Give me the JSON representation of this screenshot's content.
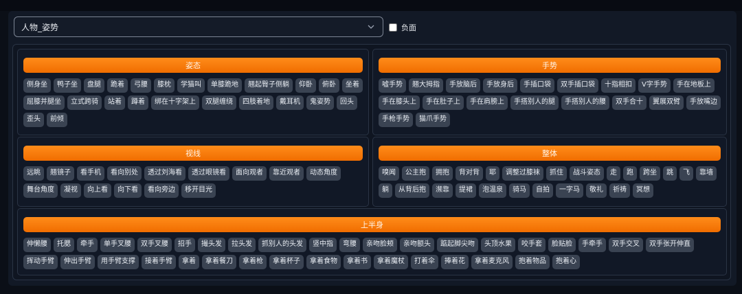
{
  "dropdown": {
    "value": "人物_姿势"
  },
  "negative": {
    "label": "负面",
    "checked": false
  },
  "sections": [
    {
      "title": "姿态",
      "tags": [
        "侧身坐",
        "鸭子坐",
        "盘腿",
        "跪着",
        "弓腰",
        "膝枕",
        "学猫叫",
        "单膝跪地",
        "翘起臀子侧躺",
        "仰卧",
        "俯卧",
        "坐着",
        "屈膝并腿坐",
        "立式跨骑",
        "站着",
        "蹲着",
        "绑在十字架上",
        "双腿缠绕",
        "四肢着地",
        "戴耳机",
        "鬼姿势",
        "回头",
        "歪头",
        "前倾"
      ]
    },
    {
      "title": "手势",
      "tags": [
        "嘘手势",
        "翘大拇指",
        "手放脑后",
        "手放身后",
        "手插口袋",
        "双手插口袋",
        "十指相扣",
        "V字手势",
        "手在地板上",
        "手在膝头上",
        "手在肚子上",
        "手在肩膀上",
        "手搭别人的腿",
        "手搭别人的腰",
        "双手合十",
        "翼展双臂",
        "手放嘴边",
        "手枪手势",
        "猫爪手势"
      ]
    },
    {
      "title": "视线",
      "tags": [
        "远眺",
        "翘镜子",
        "看手机",
        "看向别处",
        "透过刘海看",
        "透过眼镜看",
        "面向观者",
        "靠近观者",
        "动态角度",
        "舞台角度",
        "凝视",
        "向上看",
        "向下看",
        "看向旁边",
        "移开目光"
      ]
    },
    {
      "title": "整体",
      "tags": [
        "嗅闻",
        "公主抱",
        "拥抱",
        "背对背",
        "耶",
        "调整过膝袜",
        "抓住",
        "战斗姿态",
        "走",
        "跑",
        "跨坐",
        "跳",
        "飞",
        "靠墙",
        "躺",
        "从背后抱",
        "濒靠",
        "提裙",
        "泡温泉",
        "骑马",
        "自拍",
        "一字马",
        "敬礼",
        "祈祷",
        "冥想"
      ]
    },
    {
      "title": "上半身",
      "tags": [
        "伸懒腰",
        "托腮",
        "牵手",
        "单手叉腰",
        "双手叉腰",
        "招手",
        "撮头发",
        "拉头发",
        "抓别人的头发",
        "竖中指",
        "弯腰",
        "亲吻脸颊",
        "亲吻额头",
        "踮起脚尖吻",
        "头顶水果",
        "咬手套",
        "脸贴脸",
        "手牵手",
        "双手交叉",
        "双手张开伸直",
        "挥动手臂",
        "伸出手臂",
        "用手臂支撑",
        "接着手臂",
        "拿着",
        "拿着餐刀",
        "拿着枪",
        "拿着杯子",
        "拿着食物",
        "拿着书",
        "拿着魔杖",
        "打着伞",
        "捧着花",
        "拿着麦克风",
        "抱着物品",
        "抱着心"
      ]
    }
  ]
}
